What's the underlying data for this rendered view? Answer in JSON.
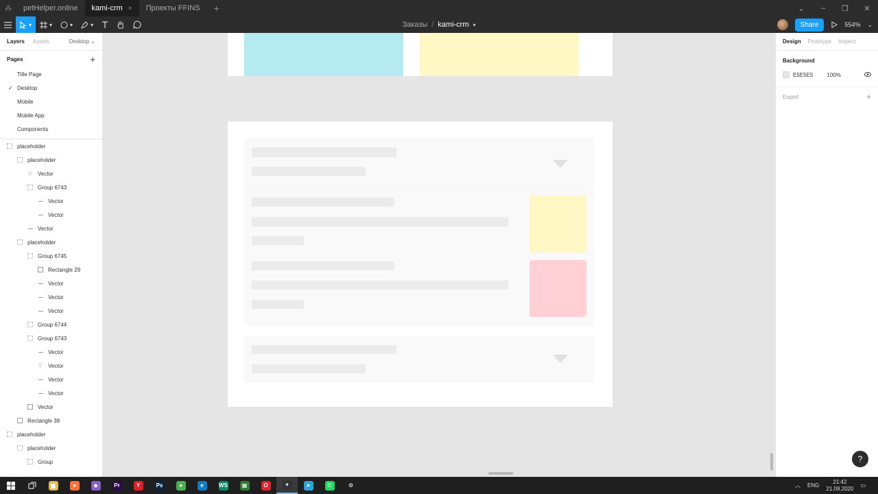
{
  "titlebar": {
    "tabs": [
      {
        "label": "petHelper.online",
        "active": false
      },
      {
        "label": "kami-crm",
        "active": true
      },
      {
        "label": "Проекты FFINS",
        "active": false
      }
    ],
    "add_tab": "+",
    "close_glyph": "×",
    "window_controls": [
      "⌄",
      "–",
      "❐",
      "✕"
    ]
  },
  "toolbar": {
    "menu_icon": "hamburger-icon",
    "tools": [
      "move-tool",
      "frame-tool",
      "shape-tool",
      "pen-tool",
      "text-tool",
      "hand-tool",
      "comment-tool"
    ],
    "breadcrumb_project": "Заказы",
    "breadcrumb_sep": "/",
    "file_name": "kami-crm",
    "share_label": "Share",
    "zoom": "554%"
  },
  "left_panel": {
    "tab_layers": "Layers",
    "tab_assets": "Assets",
    "page_dropdown": "Desktop ⌄",
    "pages_title": "Pages",
    "pages": [
      {
        "label": "Title Page",
        "current": false
      },
      {
        "label": "Desktop",
        "current": true
      },
      {
        "label": "Mobile",
        "current": false
      },
      {
        "label": "Mobile App",
        "current": false
      },
      {
        "label": "Components",
        "current": false
      }
    ],
    "layers": [
      {
        "label": "placeholder",
        "indent": 0,
        "icon": "frame"
      },
      {
        "label": "placeholder",
        "indent": 1,
        "icon": "frame"
      },
      {
        "label": "Vector",
        "indent": 2,
        "icon": "triangle"
      },
      {
        "label": "Group 6743",
        "indent": 2,
        "icon": "frame"
      },
      {
        "label": "Vector",
        "indent": 3,
        "icon": "line"
      },
      {
        "label": "Vector",
        "indent": 3,
        "icon": "line"
      },
      {
        "label": "Vector",
        "indent": 2,
        "icon": "line"
      },
      {
        "label": "placeholder",
        "indent": 1,
        "icon": "frame"
      },
      {
        "label": "Group 6745",
        "indent": 2,
        "icon": "frame"
      },
      {
        "label": "Rectangle 29",
        "indent": 3,
        "icon": "rect"
      },
      {
        "label": "Vector",
        "indent": 3,
        "icon": "line"
      },
      {
        "label": "Vector",
        "indent": 3,
        "icon": "line"
      },
      {
        "label": "Vector",
        "indent": 3,
        "icon": "line"
      },
      {
        "label": "Group 6744",
        "indent": 2,
        "icon": "frame"
      },
      {
        "label": "Group 6743",
        "indent": 2,
        "icon": "frame"
      },
      {
        "label": "Vector",
        "indent": 3,
        "icon": "line"
      },
      {
        "label": "Vector",
        "indent": 3,
        "icon": "triangle"
      },
      {
        "label": "Vector",
        "indent": 3,
        "icon": "line"
      },
      {
        "label": "Vector",
        "indent": 3,
        "icon": "line"
      },
      {
        "label": "Vector",
        "indent": 2,
        "icon": "rect"
      },
      {
        "label": "Rectangle 38",
        "indent": 1,
        "icon": "rect"
      },
      {
        "label": "placeholder",
        "indent": 0,
        "icon": "frame"
      },
      {
        "label": "placeholder",
        "indent": 1,
        "icon": "frame"
      },
      {
        "label": "Group",
        "indent": 2,
        "icon": "frame"
      }
    ]
  },
  "right_panel": {
    "tab_design": "Design",
    "tab_prototype": "Prototype",
    "tab_inspect": "Inspect",
    "background_title": "Background",
    "background_hex": "E5E5E5",
    "background_opacity": "100%",
    "export_title": "Export",
    "help_label": "?"
  },
  "canvas": {
    "bg_color": "#e5e5e5",
    "top_card_colors": [
      "#b4ebf0",
      "#fff8c4"
    ],
    "thumb_colors": [
      "#fff8c4",
      "#ffd1d6"
    ]
  },
  "taskbar": {
    "apps": [
      {
        "name": "file-explorer-icon",
        "glyph": "▆",
        "color": "#e8b84a"
      },
      {
        "name": "firefox-icon",
        "glyph": "●",
        "color": "#ff7139"
      },
      {
        "name": "visual-studio-icon",
        "glyph": "◆",
        "color": "#8661c5"
      },
      {
        "name": "premiere-icon",
        "glyph": "Pr",
        "color": "#2a0a4a"
      },
      {
        "name": "yandex-browser-icon",
        "glyph": "Y",
        "color": "#e31e24"
      },
      {
        "name": "photoshop-icon",
        "glyph": "Ps",
        "color": "#0a2540"
      },
      {
        "name": "chrome-icon",
        "glyph": "●",
        "color": "#4caf50"
      },
      {
        "name": "edge-icon",
        "glyph": "e",
        "color": "#0f7bc4"
      },
      {
        "name": "webstorm-icon",
        "glyph": "WS",
        "color": "#0a8a6a"
      },
      {
        "name": "sheets-icon",
        "glyph": "▦",
        "color": "#2e7d32"
      },
      {
        "name": "opera-icon",
        "glyph": "O",
        "color": "#e0232e"
      },
      {
        "name": "figma-icon",
        "glyph": "✦",
        "color": "#333333"
      },
      {
        "name": "telegram-icon",
        "glyph": "➤",
        "color": "#2aa3df"
      },
      {
        "name": "whatsapp-icon",
        "glyph": "✆",
        "color": "#25d366"
      },
      {
        "name": "settings-icon",
        "glyph": "⚙",
        "color": "#1f1f1f"
      }
    ],
    "lang": "ENG",
    "time": "21:42",
    "date": "21.09.2020"
  }
}
